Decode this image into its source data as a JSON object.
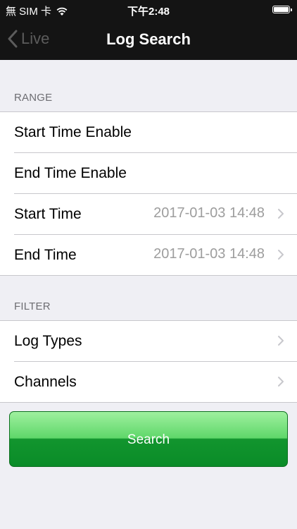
{
  "status_bar": {
    "carrier": "無 SIM 卡",
    "time": "下午2:48"
  },
  "nav": {
    "back_label": "Live",
    "title": "Log Search"
  },
  "range": {
    "header": "RANGE",
    "rows": [
      {
        "label": "Start Time Enable"
      },
      {
        "label": "End Time Enable"
      },
      {
        "label": "Start Time",
        "value": "2017-01-03 14:48"
      },
      {
        "label": "End Time",
        "value": "2017-01-03 14:48"
      }
    ]
  },
  "filter": {
    "header": "FILTER",
    "rows": [
      {
        "label": "Log Types"
      },
      {
        "label": "Channels"
      }
    ]
  },
  "search_button": {
    "label": "Search"
  },
  "colors": {
    "button_green": "#12952e",
    "nav_bg": "#141414",
    "background": "#efeff4"
  }
}
